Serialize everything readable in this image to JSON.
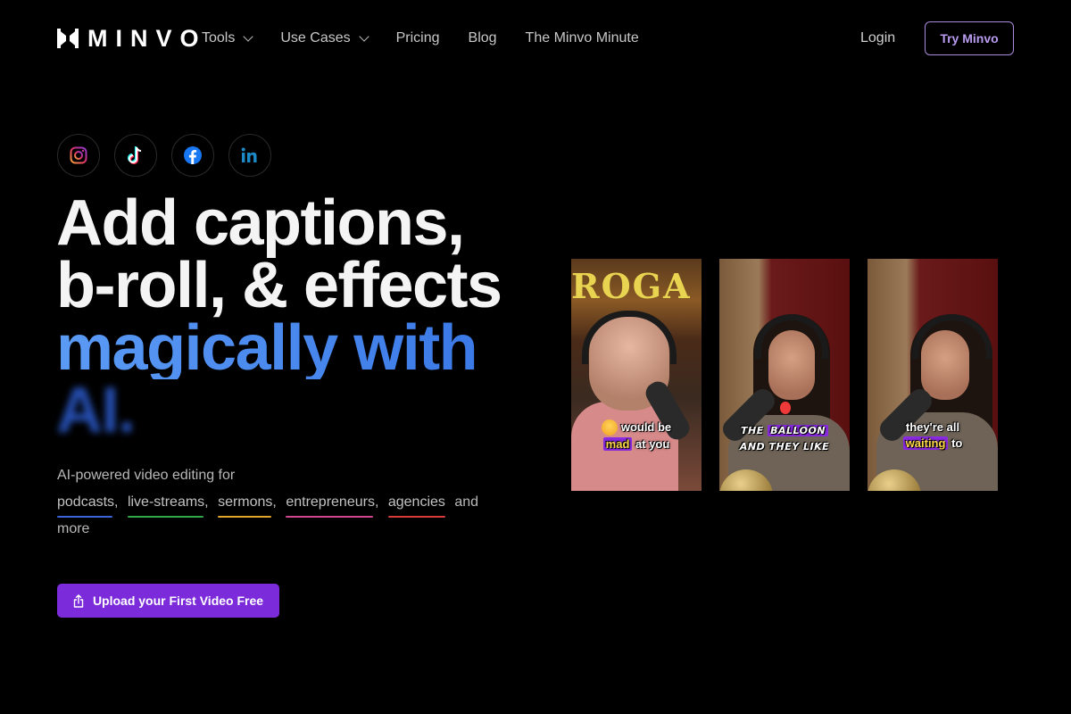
{
  "nav": {
    "logo_text": "MINVO",
    "links": [
      {
        "label": "Tools",
        "has_dropdown": true
      },
      {
        "label": "Use Cases",
        "has_dropdown": true
      },
      {
        "label": "Pricing",
        "has_dropdown": false
      },
      {
        "label": "Blog",
        "has_dropdown": false
      },
      {
        "label": "The Minvo Minute",
        "has_dropdown": false
      }
    ],
    "login_label": "Login",
    "try_label": "Try Minvo"
  },
  "socials": [
    {
      "name": "instagram",
      "icon": "instagram-icon"
    },
    {
      "name": "tiktok",
      "icon": "tiktok-icon"
    },
    {
      "name": "facebook",
      "icon": "facebook-icon"
    },
    {
      "name": "linkedin",
      "icon": "linkedin-icon"
    }
  ],
  "hero": {
    "line1": "Add captions,",
    "line2": "b-roll, & effects",
    "line3": "magically with",
    "line4": "AI.",
    "sub_intro": "AI-powered video editing for",
    "tags": [
      {
        "label": "podcasts,",
        "color": "#3d63d8"
      },
      {
        "label": "live-streams,",
        "color": "#2ea84a"
      },
      {
        "label": "sermons,",
        "color": "#e0a52a"
      },
      {
        "label": "entrepreneurs,",
        "color": "#d0478e"
      },
      {
        "label": "agencies",
        "color": "#d83b3b"
      }
    ],
    "sub_tail_1": "and",
    "sub_tail_2": "more",
    "cta_label": "Upload your First Video Free"
  },
  "videos": [
    {
      "caption_line1": "would be",
      "caption_highlight": "mad",
      "caption_line2_rest": "at you"
    },
    {
      "caption_line1_pre": "THE",
      "caption_highlight": "BALLOON",
      "caption_line2": "AND THEY LIKE"
    },
    {
      "caption_line1": "they're all",
      "caption_highlight": "waiting",
      "caption_line2_rest": "to"
    }
  ],
  "colors": {
    "accent_purple": "#7b2bd9",
    "try_border": "#a98adb",
    "headline_blue": "#4a8af0"
  }
}
